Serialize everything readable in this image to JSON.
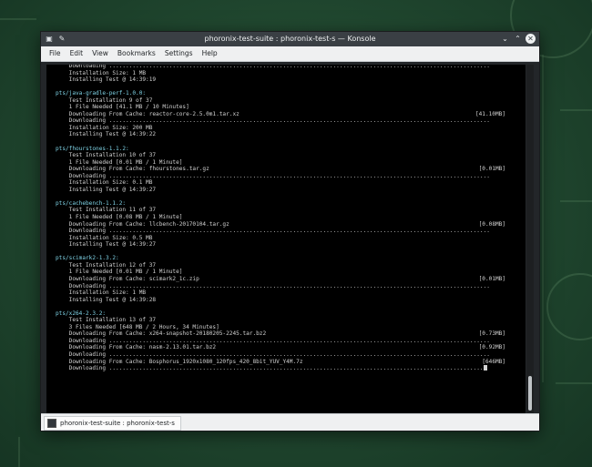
{
  "window": {
    "title": "phoronix-test-suite : phoronix-test-s — Konsole",
    "left_icons": [
      "terminal-icon",
      "pin-icon"
    ],
    "buttons": {
      "minimize": "⌄",
      "maximize": "⌃",
      "close": "✕"
    }
  },
  "menubar": [
    "File",
    "Edit",
    "View",
    "Bookmarks",
    "Settings",
    "Help"
  ],
  "terminal": {
    "lines": [
      {
        "t": "    Downloading .................................................................................................................."
      },
      {
        "t": "    Installation Size: 1 MB"
      },
      {
        "t": "    Installing Test @ 14:39:19"
      },
      {
        "t": ""
      },
      {
        "t": "pts/java-gradle-perf-1.0.0:",
        "hdr": true
      },
      {
        "t": "    Test Installation 9 of 37"
      },
      {
        "t": "    1 File Needed [41.1 MB / 10 Minutes]"
      },
      {
        "t": "    Downloading From Cache: reactor-core-2.5.0m1.tar.xz",
        "r": "[41.10MB]"
      },
      {
        "t": "    Downloading .................................................................................................................."
      },
      {
        "t": "    Installation Size: 200 MB"
      },
      {
        "t": "    Installing Test @ 14:39:22"
      },
      {
        "t": ""
      },
      {
        "t": "pts/fhourstones-1.1.2:",
        "hdr": true
      },
      {
        "t": "    Test Installation 10 of 37"
      },
      {
        "t": "    1 File Needed [0.01 MB / 1 Minute]"
      },
      {
        "t": "    Downloading From Cache: fhourstones.tar.gz",
        "r": "[0.01MB]"
      },
      {
        "t": "    Downloading .................................................................................................................."
      },
      {
        "t": "    Installation Size: 0.1 MB"
      },
      {
        "t": "    Installing Test @ 14:39:27"
      },
      {
        "t": ""
      },
      {
        "t": "pts/cachebench-1.1.2:",
        "hdr": true
      },
      {
        "t": "    Test Installation 11 of 37"
      },
      {
        "t": "    1 File Needed [0.08 MB / 1 Minute]"
      },
      {
        "t": "    Downloading From Cache: llcbench-20170104.tar.gz",
        "r": "[0.08MB]"
      },
      {
        "t": "    Downloading .................................................................................................................."
      },
      {
        "t": "    Installation Size: 0.5 MB"
      },
      {
        "t": "    Installing Test @ 14:39:27"
      },
      {
        "t": ""
      },
      {
        "t": "pts/scimark2-1.3.2:",
        "hdr": true
      },
      {
        "t": "    Test Installation 12 of 37"
      },
      {
        "t": "    1 File Needed [0.01 MB / 1 Minute]"
      },
      {
        "t": "    Downloading From Cache: scimark2_1c.zip",
        "r": "[0.01MB]"
      },
      {
        "t": "    Downloading .................................................................................................................."
      },
      {
        "t": "    Installation Size: 1 MB"
      },
      {
        "t": "    Installing Test @ 14:39:28"
      },
      {
        "t": ""
      },
      {
        "t": "pts/x264-2.3.2:",
        "hdr": true
      },
      {
        "t": "    Test Installation 13 of 37"
      },
      {
        "t": "    3 Files Needed [648 MB / 2 Hours, 34 Minutes]"
      },
      {
        "t": "    Downloading From Cache: x264-snapshot-20180205-2245.tar.bz2",
        "r": "[0.73MB]"
      },
      {
        "t": "    Downloading .................................................................................................................."
      },
      {
        "t": "    Downloading From Cache: nasm-2.13.01.tar.bz2",
        "r": "[0.92MB]"
      },
      {
        "t": "    Downloading .................................................................................................................."
      },
      {
        "t": "    Downloading From Cache: Bosphorus_1920x1080_120fps_420_8bit_YUV_Y4M.7z",
        "r": "[646MB]"
      },
      {
        "t": "    Downloading ................................................................................................................",
        "cursor": true
      }
    ]
  },
  "tab": {
    "label": "phoronix-test-suite : phoronix-test-s"
  }
}
